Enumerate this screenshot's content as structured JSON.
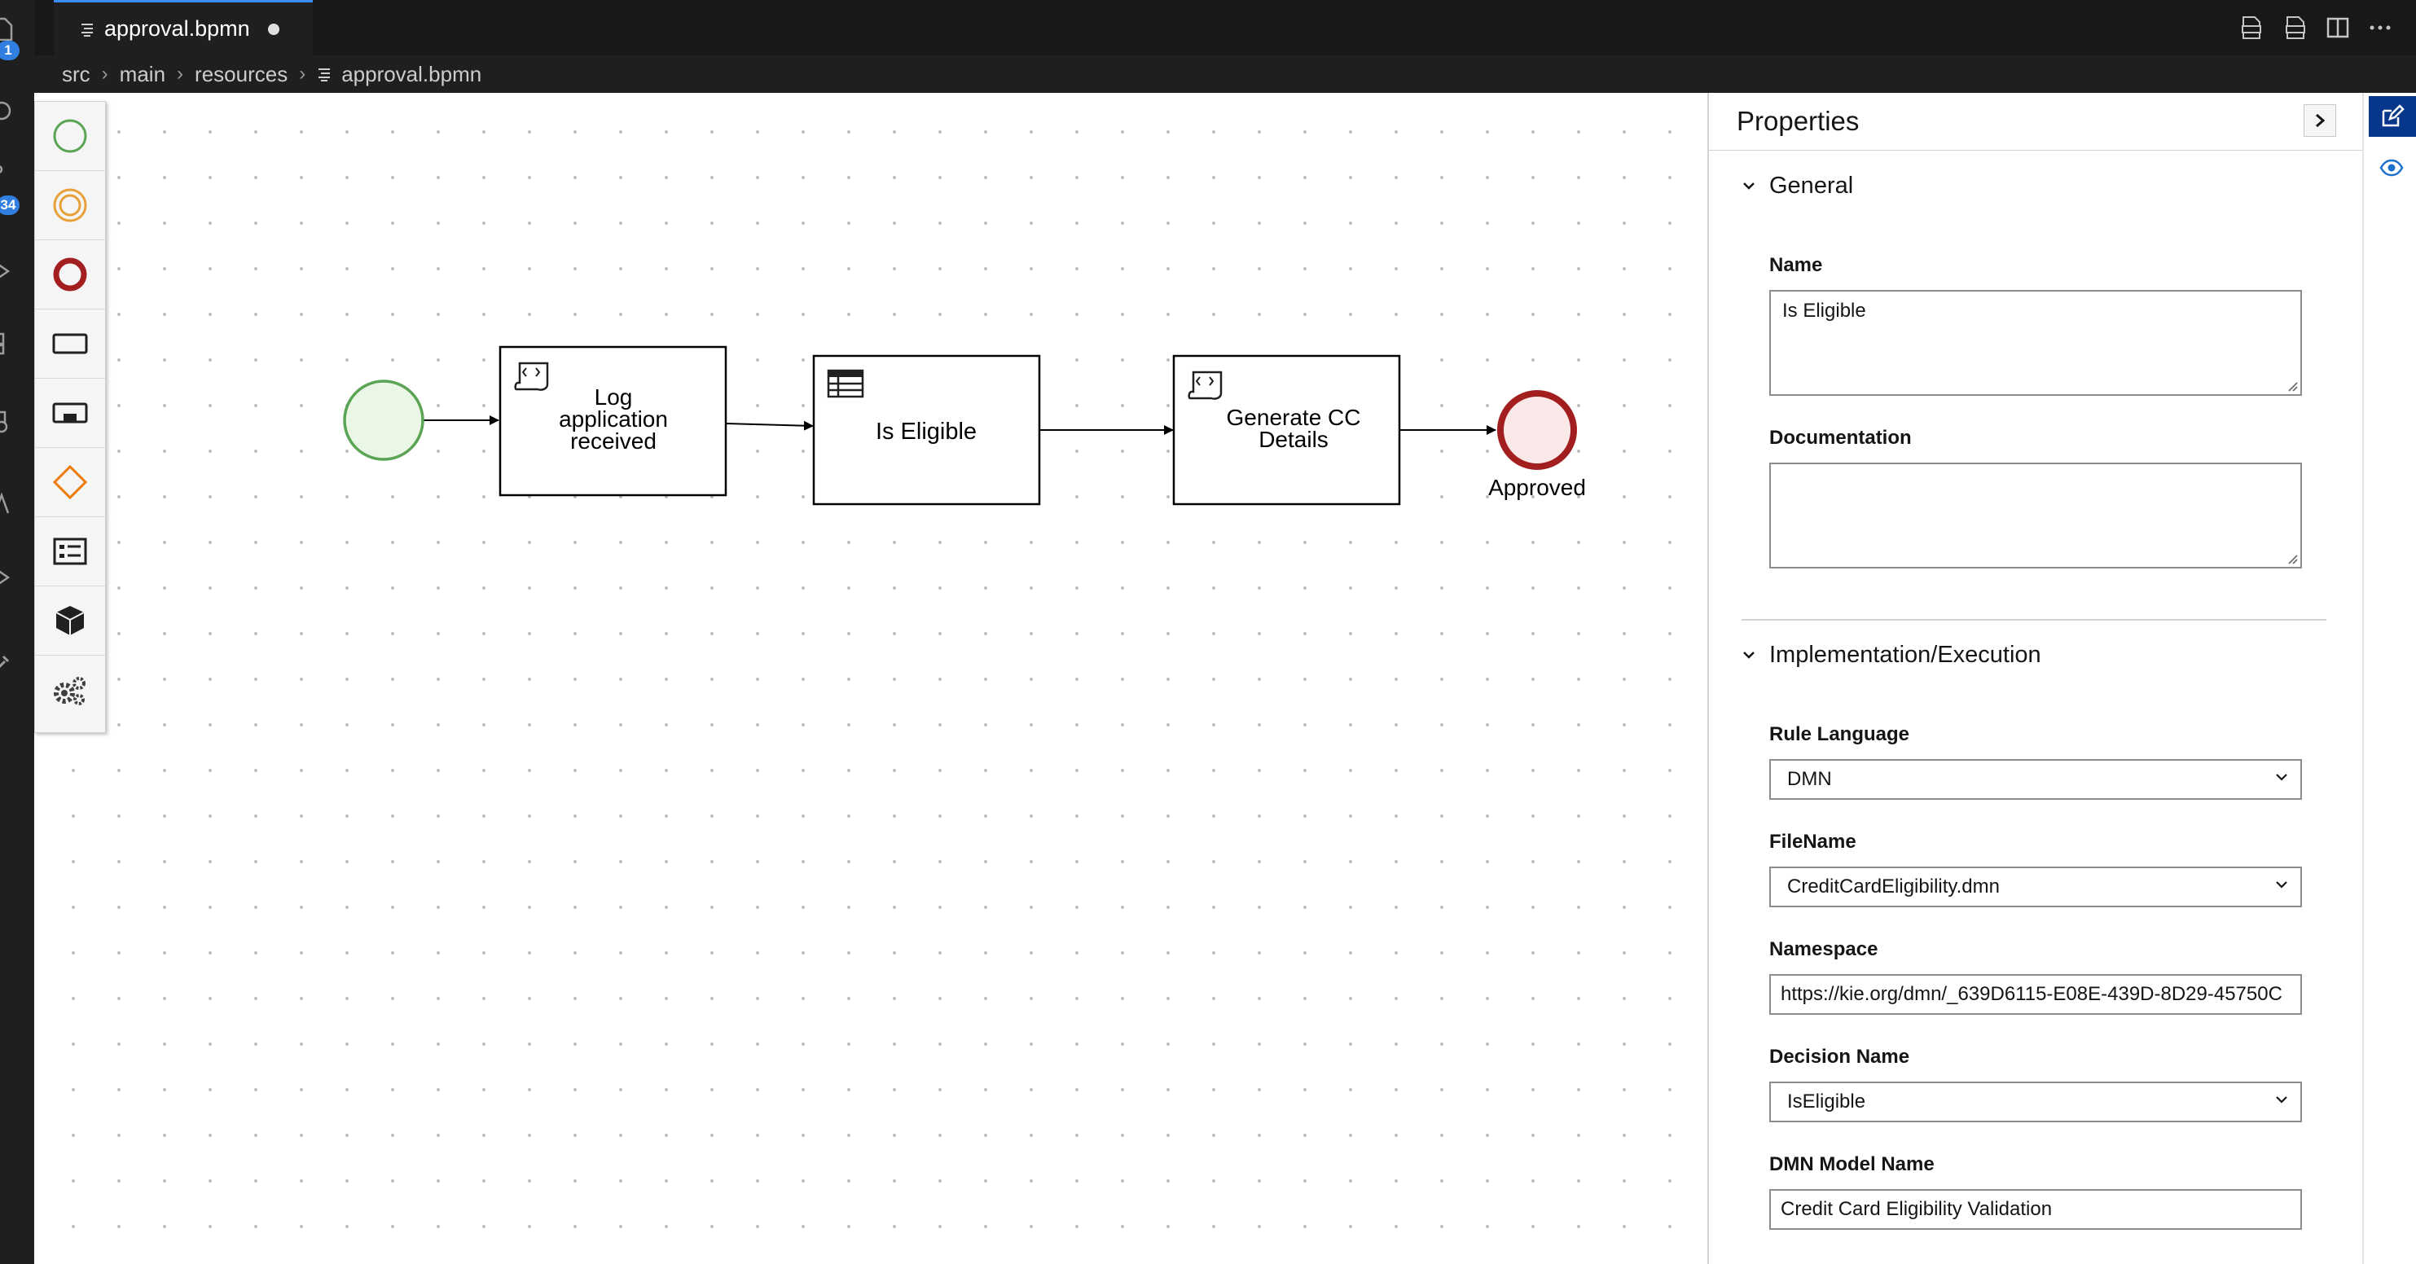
{
  "tab": {
    "label": "approval.bpmn",
    "dirty": true
  },
  "breadcrumb": [
    "src",
    "main",
    "resources",
    "approval.bpmn"
  ],
  "activity_badges": {
    "explorer": "1",
    "source_control": "34"
  },
  "palette": {
    "items": [
      "start-event",
      "intermediate-event",
      "end-event",
      "task",
      "subprocess",
      "gateway",
      "data-object",
      "custom-task",
      "settings"
    ]
  },
  "diagram": {
    "nodes": {
      "log_task": [
        "Log",
        "application",
        "received"
      ],
      "eligible_task": [
        "Is Eligible"
      ],
      "generate_task": [
        "Generate CC",
        "Details"
      ],
      "end_label": "Approved"
    }
  },
  "properties": {
    "title": "Properties",
    "general": {
      "heading": "General",
      "name_label": "Name",
      "name_value": "Is Eligible",
      "documentation_label": "Documentation",
      "documentation_value": ""
    },
    "implementation": {
      "heading": "Implementation/Execution",
      "rule_language_label": "Rule Language",
      "rule_language_value": "DMN",
      "filename_label": "FileName",
      "filename_value": "CreditCardEligibility.dmn",
      "namespace_label": "Namespace",
      "namespace_value": "https://kie.org/dmn/_639D6115-E08E-439D-8D29-45750C",
      "decision_name_label": "Decision Name",
      "decision_name_value": "IsEligible",
      "dmn_model_label": "DMN Model Name",
      "dmn_model_value": "Credit Card Eligibility Validation"
    }
  },
  "colors": {
    "start_stroke": "#5aa454",
    "start_fill": "#ebf7e6",
    "intermediate_stroke": "#e8a13a",
    "end_stroke": "#a31f1f",
    "end_fill": "#fbe9ea",
    "gateway_stroke": "#ec7a08",
    "accent": "#06378a"
  }
}
